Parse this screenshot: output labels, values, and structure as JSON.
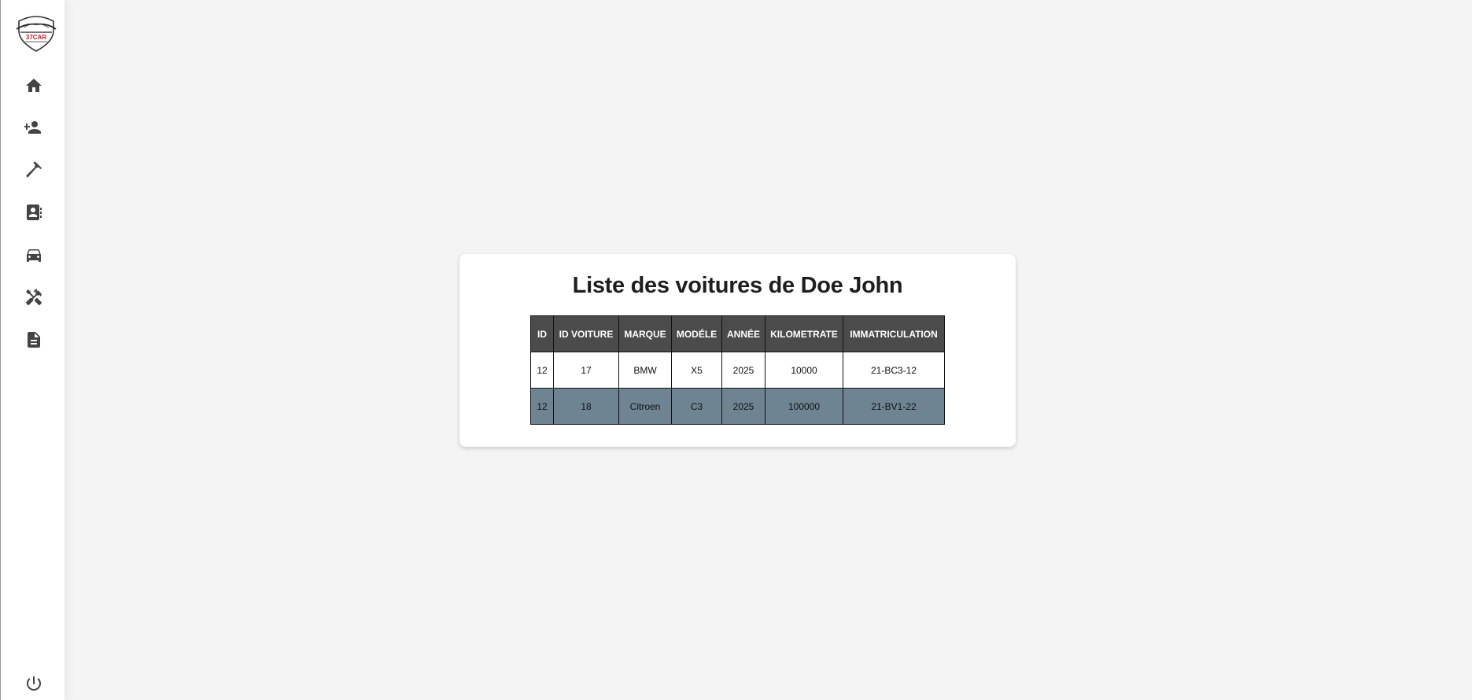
{
  "sidebar": {
    "logo_text": "37CAR",
    "items": [
      {
        "icon": "home-icon"
      },
      {
        "icon": "add-user-icon"
      },
      {
        "icon": "hammer-icon"
      },
      {
        "icon": "contacts-icon"
      },
      {
        "icon": "car-icon"
      },
      {
        "icon": "tools-icon"
      },
      {
        "icon": "document-icon"
      }
    ],
    "logout_icon": "power-icon"
  },
  "card": {
    "title": "Liste des voitures de Doe John",
    "table": {
      "headers": [
        "ID",
        "ID VOITURE",
        "MARQUE",
        "MODÉLE",
        "ANNÉE",
        "KILOMETRATE",
        "IMMATRICULATION"
      ],
      "rows": [
        [
          "12",
          "17",
          "BMW",
          "X5",
          "2025",
          "10000",
          "21-BC3-12"
        ],
        [
          "12",
          "18",
          "Citroen",
          "C3",
          "2025",
          "100000",
          "21-BV1-22"
        ]
      ]
    }
  },
  "colors": {
    "background": "#f4f4f4",
    "header_bg": "#4b4b4b",
    "alt_row_bg": "#6f8492",
    "logo_accent": "#d0202e"
  }
}
